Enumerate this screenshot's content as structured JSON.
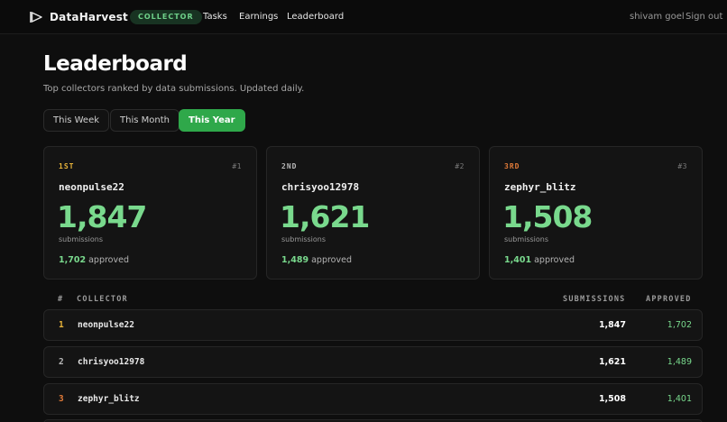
{
  "nav": {
    "brand": "DataHarvest",
    "role_badge": "COLLECTOR",
    "links": [
      "Tasks",
      "Earnings",
      "Leaderboard"
    ],
    "user_name": "shivam goel",
    "sign_out": "Sign out",
    "brand_icon": "play-arrow-icon"
  },
  "page": {
    "title": "Leaderboard",
    "subtitle": "Top collectors ranked by data submissions. Updated daily."
  },
  "periods": {
    "options": [
      "This Week",
      "This Month",
      "This Year"
    ],
    "selected": "This Year"
  },
  "podium": [
    {
      "rank_word": "1ST",
      "rank_num": "#1",
      "username": "neonpulse22",
      "submissions": "1,847",
      "submissions_label": "submissions",
      "approved": "1,702",
      "approved_label": "approved",
      "accent": "#e8b43a"
    },
    {
      "rank_word": "2ND",
      "rank_num": "#2",
      "username": "chrisyoo12978",
      "submissions": "1,621",
      "submissions_label": "submissions",
      "approved": "1,489",
      "approved_label": "approved",
      "accent": "#b9b9b9"
    },
    {
      "rank_word": "3RD",
      "rank_num": "#3",
      "username": "zephyr_blitz",
      "submissions": "1,508",
      "submissions_label": "submissions",
      "approved": "1,401",
      "approved_label": "approved",
      "accent": "#e07a38"
    }
  ],
  "table": {
    "headers": {
      "rank": "#",
      "collector": "COLLECTOR",
      "submissions": "SUBMISSIONS",
      "approved": "APPROVED"
    },
    "rows": [
      {
        "rank": "1",
        "collector": "neonpulse22",
        "submissions": "1,847",
        "approved": "1,702"
      },
      {
        "rank": "2",
        "collector": "chrisyoo12978",
        "submissions": "1,621",
        "approved": "1,489"
      },
      {
        "rank": "3",
        "collector": "zephyr_blitz",
        "submissions": "1,508",
        "approved": "1,401"
      }
    ]
  },
  "colors": {
    "accent_green": "#2fa84a",
    "value_green": "#79d98d",
    "gold": "#e8b43a",
    "silver": "#b9b9b9",
    "bronze": "#e07a38"
  }
}
